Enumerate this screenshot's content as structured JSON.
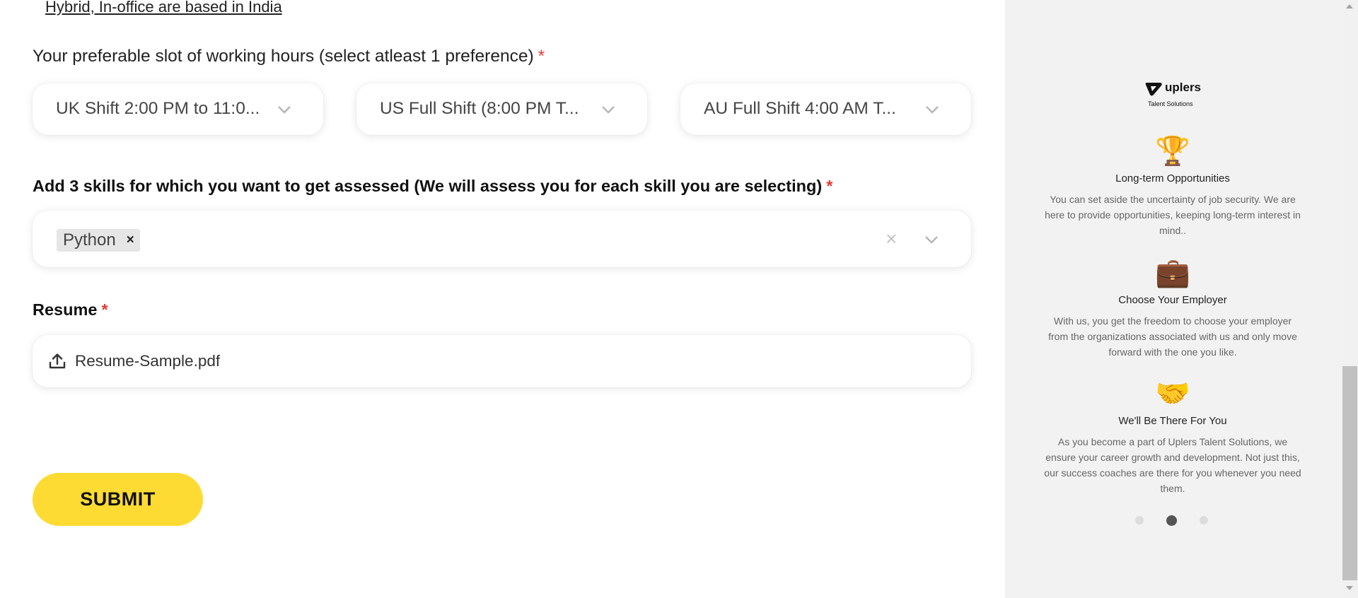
{
  "form": {
    "location_link": "Hybrid, In-office are based in India",
    "hours_label": "Your preferable slot of working hours (select atleast 1 preference)",
    "required_mark": "*",
    "shifts": [
      {
        "value": "UK Shift 2:00 PM to 11:0..."
      },
      {
        "value": "US Full Shift (8:00 PM T..."
      },
      {
        "value": "AU Full Shift 4:00 AM T..."
      }
    ],
    "skills_label": "Add 3 skills for which you want to get assessed (We will assess you for each skill you are selecting)",
    "skills": {
      "selected": [
        {
          "label": "Python",
          "remove": "×"
        }
      ],
      "clear": "×"
    },
    "resume_label": "Resume",
    "resume_file": "Resume-Sample.pdf",
    "submit_label": "SUBMIT"
  },
  "sidebar": {
    "logo_text": "uplers",
    "logo_sub": "Talent Solutions",
    "features": [
      {
        "icon": "trophy-icon",
        "emoji": "🏆",
        "title": "Long-term Opportunities",
        "desc": "You can set aside the uncertainty of job security. We are here to provide opportunities, keeping long-term interest in mind.."
      },
      {
        "icon": "briefcase-icon",
        "emoji": "💼",
        "title": "Choose Your Employer",
        "desc": "With us, you get the freedom to choose your employer from the organizations associated with us and only move forward with the one you like."
      },
      {
        "icon": "handshake-icon",
        "emoji": "🤝",
        "title": "We'll Be There For You",
        "desc": "As you become a part of Uplers Talent Solutions, we ensure your career growth and development. Not just this, our success coaches are there for you whenever you need them."
      }
    ],
    "carousel": {
      "slides": 3,
      "active": 2
    }
  },
  "colors": {
    "accent": "#fddb33",
    "required": "#e53935",
    "sidebar_bg": "#f2f2f2"
  }
}
